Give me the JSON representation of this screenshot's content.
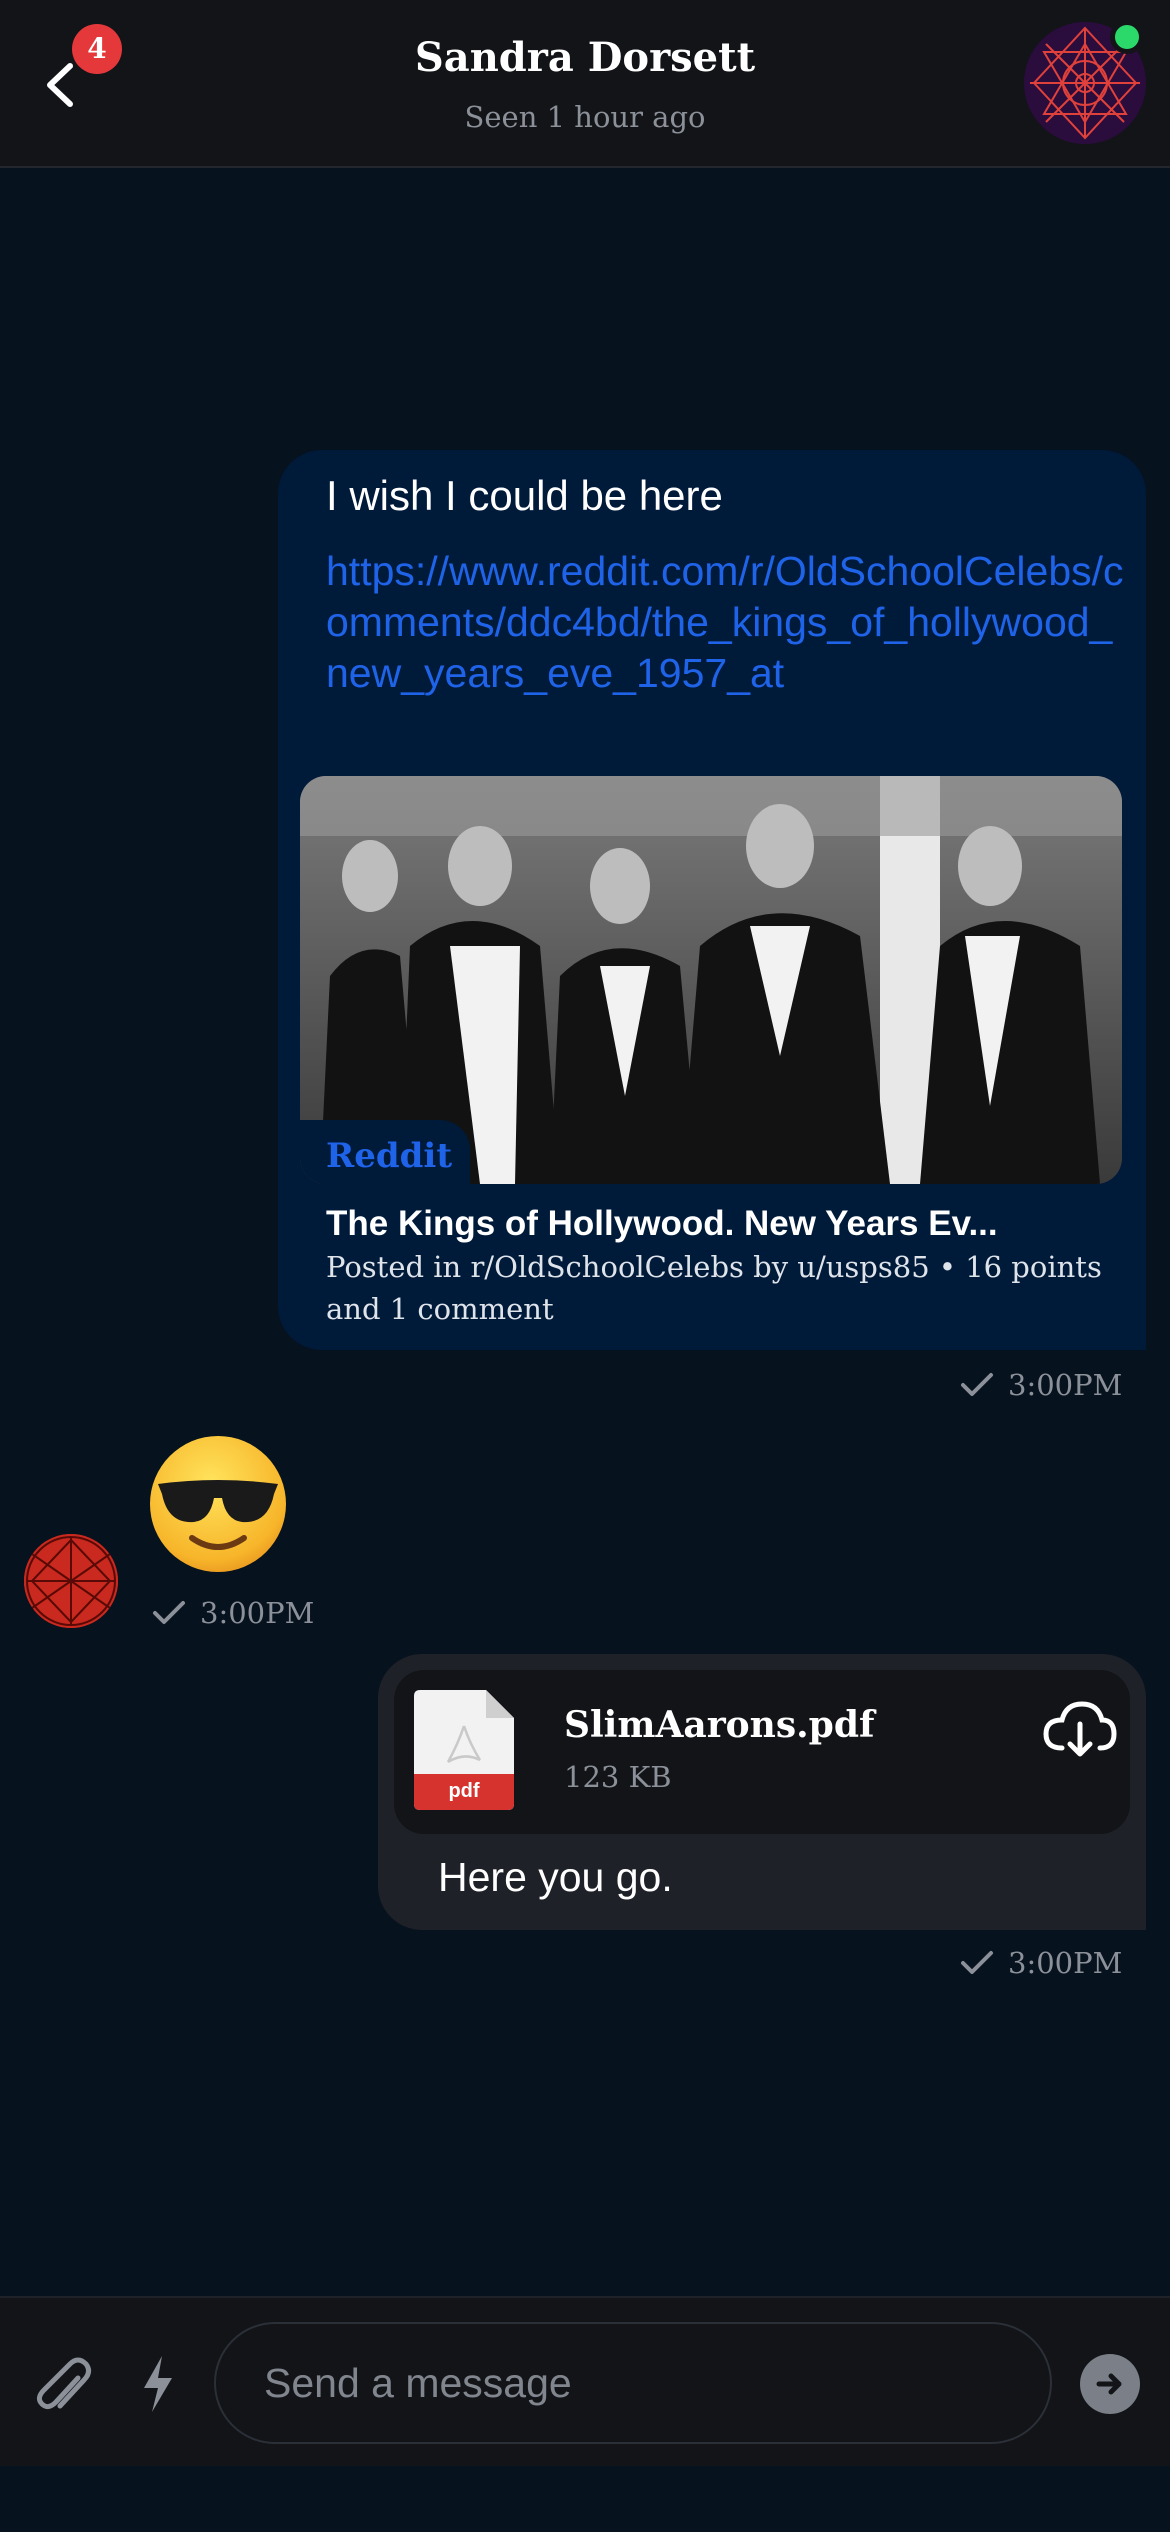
{
  "header": {
    "badge_count": "4",
    "contact_name": "Sandra Dorsett",
    "status": "Seen 1 hour ago",
    "online": true
  },
  "messages": {
    "link_message": {
      "text": "I wish I could be here",
      "url": "https://www.reddit.com/r/OldSchoolCelebs/comments/ddc4bd/the_kings_of_hollywood_new_years_eve_1957_at",
      "preview_source": "Reddit",
      "preview_title": "The Kings of Hollywood. New Years Ev...",
      "preview_meta": "Posted in r/OldSchoolCelebs by u/usps85 • 16 points and 1 comment",
      "time": "3:00PM"
    },
    "emoji_message": {
      "emoji": "smiling-face-with-sunglasses",
      "time": "3:00PM"
    },
    "file_message": {
      "file_name": "SlimAarons.pdf",
      "file_size": "123 KB",
      "file_type_label": "pdf",
      "caption": "Here you go.",
      "time": "3:00PM"
    }
  },
  "composer": {
    "placeholder": "Send a message"
  },
  "colors": {
    "background": "#07121f",
    "header": "#121418",
    "link_bubble": "#001a3a",
    "link": "#1f63e8",
    "file_bubble": "#1e2127",
    "badge": "#e5383b",
    "online": "#2bd96b",
    "pdf_red": "#d6322e"
  }
}
